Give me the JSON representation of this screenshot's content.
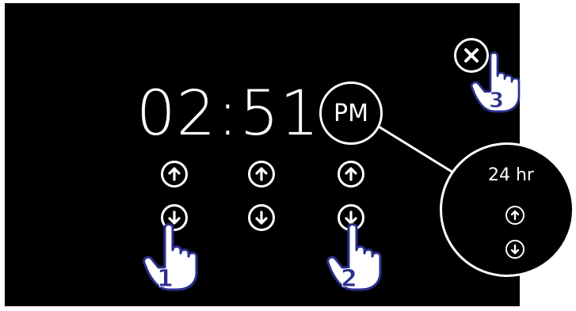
{
  "clock": {
    "hours": "02",
    "separator": ":",
    "minutes": "51",
    "period": "PM"
  },
  "zoom_callout": {
    "label": "24 hr"
  },
  "gesture_steps": [
    "1",
    "2",
    "3"
  ],
  "icons": {
    "up": "arrow-up-icon",
    "down": "arrow-down-icon",
    "close": "close-icon",
    "hand": "pointing-hand-icon"
  },
  "colors": {
    "screen": "#000000",
    "foreground": "#ffffff",
    "badge": "#2a2f8f"
  }
}
